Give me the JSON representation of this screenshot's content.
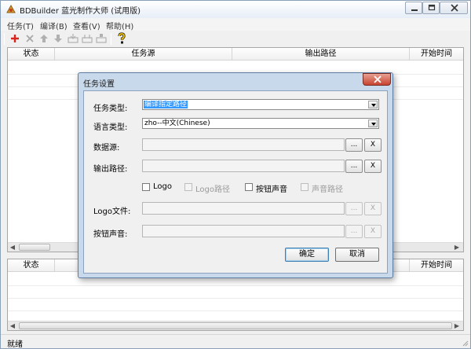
{
  "window": {
    "title": "BDBuilder 蓝光制作大师 (试用版)"
  },
  "menu": [
    {
      "label": "任务(T)"
    },
    {
      "label": "编译(B)"
    },
    {
      "label": "查看(V)"
    },
    {
      "label": "帮助(H)"
    }
  ],
  "top_grid": {
    "columns": [
      "状态",
      "任务源",
      "输出路径",
      "开始时间"
    ]
  },
  "bottom_grid": {
    "columns": [
      "状态",
      "开始时间"
    ]
  },
  "statusbar": {
    "text": "就绪"
  },
  "dialog": {
    "title": "任务设置",
    "task_type": {
      "label": "任务类型:",
      "value": "编译指定路径"
    },
    "language": {
      "label": "语言类型:",
      "value": "zho--中文(Chinese)"
    },
    "source": {
      "label": "数据源:",
      "browse": "...",
      "clear": "X"
    },
    "output": {
      "label": "输出路径:",
      "browse": "...",
      "clear": "X"
    },
    "options": {
      "logo": "Logo",
      "logo_path": "Logo路径",
      "button_sound": "按钮声音",
      "sound_path": "声音路径"
    },
    "logo_file": {
      "label": "Logo文件:",
      "browse": "...",
      "clear": "X"
    },
    "sound_file": {
      "label": "按钮声音:",
      "browse": "...",
      "clear": "X"
    },
    "ok": "确定",
    "cancel": "取消"
  },
  "colors": {
    "selection": "#3399ff",
    "dialog_frame": "#c9d9ec",
    "close_red": "#c7432f",
    "add_icon_red": "#d8241c"
  }
}
